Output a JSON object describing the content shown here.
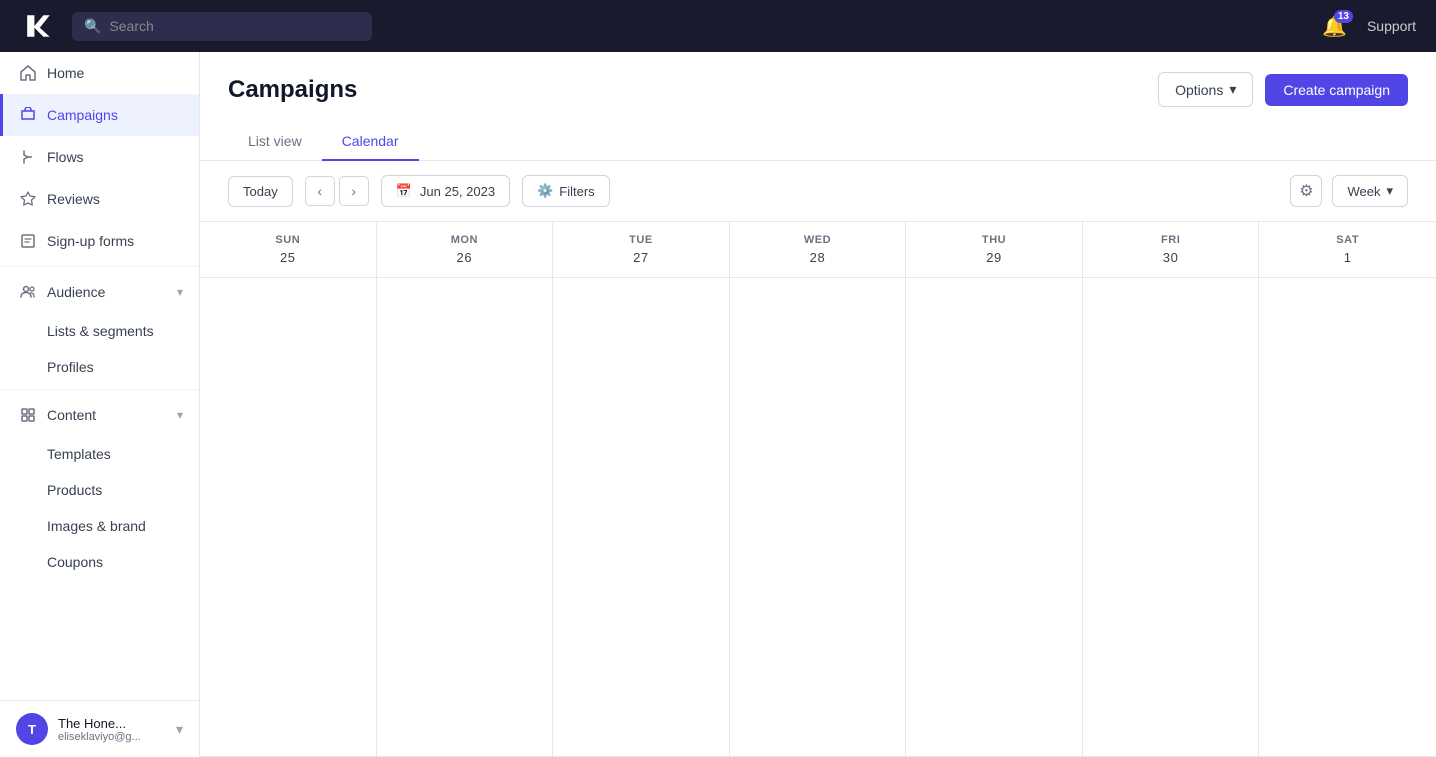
{
  "app": {
    "logo_text": "klaviyo"
  },
  "topnav": {
    "search_placeholder": "Search",
    "notification_count": "13",
    "support_label": "Support"
  },
  "sidebar": {
    "items": [
      {
        "id": "home",
        "label": "Home",
        "icon": "🏠",
        "active": false
      },
      {
        "id": "campaigns",
        "label": "Campaigns",
        "icon": "📢",
        "active": true
      },
      {
        "id": "flows",
        "label": "Flows",
        "icon": "⚡",
        "active": false
      },
      {
        "id": "reviews",
        "label": "Reviews",
        "icon": "⭐",
        "active": false
      },
      {
        "id": "sign-up-forms",
        "label": "Sign-up forms",
        "icon": "📝",
        "active": false
      }
    ],
    "expandable": [
      {
        "id": "audience",
        "label": "Audience",
        "icon": "👥",
        "expanded": true,
        "sub_items": [
          {
            "id": "lists-segments",
            "label": "Lists & segments"
          },
          {
            "id": "profiles",
            "label": "Profiles"
          }
        ]
      },
      {
        "id": "content",
        "label": "Content",
        "icon": "🗂️",
        "expanded": true,
        "sub_items": [
          {
            "id": "templates",
            "label": "Templates"
          },
          {
            "id": "products",
            "label": "Products"
          },
          {
            "id": "images-brand",
            "label": "Images & brand"
          },
          {
            "id": "coupons",
            "label": "Coupons"
          }
        ]
      }
    ],
    "user": {
      "initials": "T",
      "name": "The Hone...",
      "email": "eliseklaviyo@g..."
    }
  },
  "page": {
    "title": "Campaigns",
    "tabs": [
      {
        "id": "list-view",
        "label": "List view",
        "active": false
      },
      {
        "id": "calendar",
        "label": "Calendar",
        "active": true
      }
    ],
    "header_buttons": {
      "options": "Options",
      "create": "Create campaign"
    }
  },
  "calendar": {
    "today_label": "Today",
    "date_display": "Jun 25, 2023",
    "filters_label": "Filters",
    "week_label": "Week",
    "days": [
      {
        "abbr": "SUN",
        "date": "25"
      },
      {
        "abbr": "MON",
        "date": "26"
      },
      {
        "abbr": "TUE",
        "date": "27"
      },
      {
        "abbr": "WED",
        "date": "28"
      },
      {
        "abbr": "THU",
        "date": "29"
      },
      {
        "abbr": "FRI",
        "date": "30"
      },
      {
        "abbr": "SAT",
        "date": "1"
      }
    ]
  }
}
